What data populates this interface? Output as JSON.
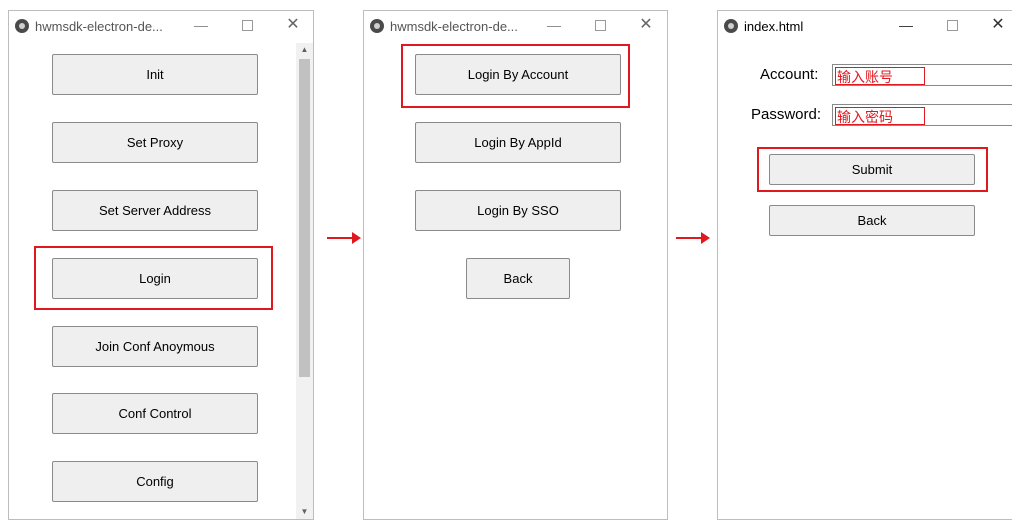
{
  "window1": {
    "title": "hwmsdk-electron-de...",
    "buttons": {
      "init": "Init",
      "set_proxy": "Set Proxy",
      "set_server_address": "Set Server Address",
      "login": "Login",
      "join_conf_anonymous": "Join Conf Anoymous",
      "conf_control": "Conf Control",
      "config": "Config"
    }
  },
  "window2": {
    "title": "hwmsdk-electron-de...",
    "buttons": {
      "login_by_account": "Login By Account",
      "login_by_appid": "Login By AppId",
      "login_by_sso": "Login By SSO",
      "back": "Back"
    }
  },
  "window3": {
    "title": "index.html",
    "account_label": "Account:",
    "account_value": "输入账号",
    "password_label": "Password:",
    "password_value": "输入密码",
    "submit": "Submit",
    "back": "Back"
  },
  "window_controls": {
    "minimize": "—",
    "close": "✕"
  },
  "icons": {
    "app": "electron-app-icon"
  },
  "colors": {
    "highlight": "#e0191f",
    "button_bg": "#efefef",
    "button_border": "#8a8a8a"
  }
}
